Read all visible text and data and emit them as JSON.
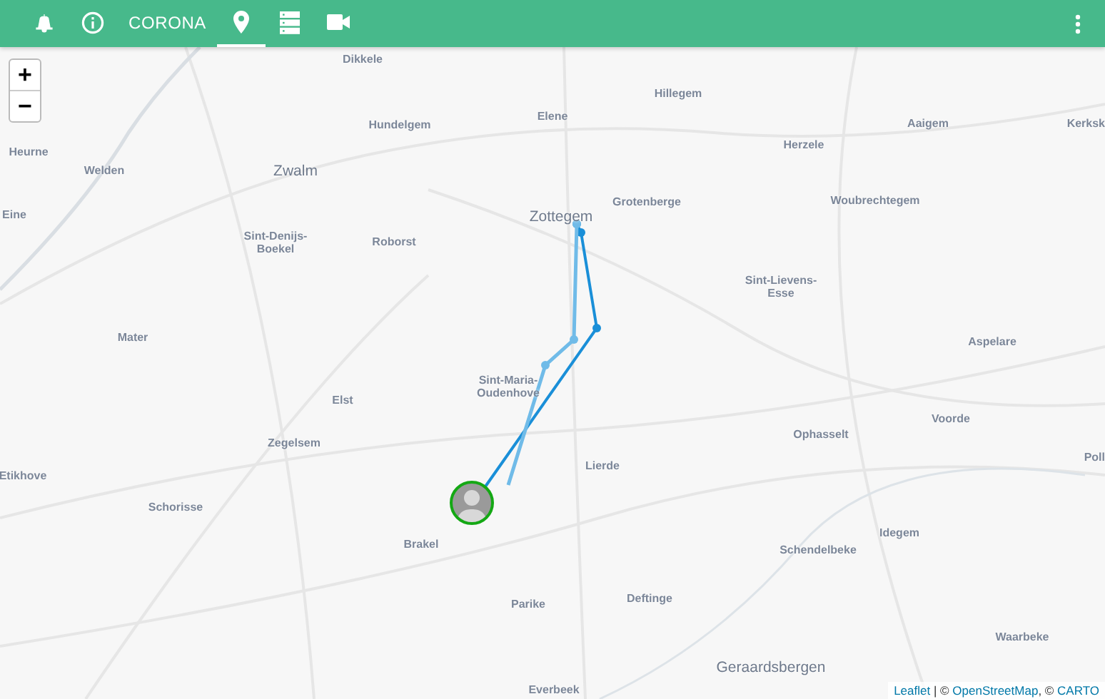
{
  "app_bar": {
    "tabs": [
      {
        "kind": "icon",
        "selected": false
      },
      {
        "kind": "icon",
        "selected": false
      },
      {
        "kind": "text",
        "label": "CORONA",
        "selected": false
      },
      {
        "kind": "icon",
        "selected": true
      },
      {
        "kind": "icon",
        "selected": false
      },
      {
        "kind": "icon",
        "selected": false
      }
    ]
  },
  "map": {
    "zoom_controls": [
      "+",
      "−"
    ],
    "place_labels": [
      {
        "text": "Dikkele",
        "kind": "village"
      },
      {
        "text": "Hundelgem",
        "kind": "village"
      },
      {
        "text": "Elene",
        "kind": "village"
      },
      {
        "text": "Hillegem",
        "kind": "village"
      },
      {
        "text": "Aaigem",
        "kind": "village"
      },
      {
        "text": "Kerksk",
        "kind": "village"
      },
      {
        "text": "Heurne",
        "kind": "village"
      },
      {
        "text": "Welden",
        "kind": "village"
      },
      {
        "text": "Zwalm",
        "kind": "town"
      },
      {
        "text": "Herzele",
        "kind": "village"
      },
      {
        "text": "Grotenberge",
        "kind": "village"
      },
      {
        "text": "Woubrechtegem",
        "kind": "village"
      },
      {
        "text": "Zottegem",
        "kind": "town"
      },
      {
        "text": "Eine",
        "kind": "village"
      },
      {
        "text": "Sint-Denijs-\nBoekel",
        "kind": "village"
      },
      {
        "text": "Roborst",
        "kind": "village"
      },
      {
        "text": "Sint-Lievens-\nEsse",
        "kind": "village"
      },
      {
        "text": "Mater",
        "kind": "village"
      },
      {
        "text": "Aspelare",
        "kind": "village"
      },
      {
        "text": "Sint-Maria-\nOudenhove",
        "kind": "village"
      },
      {
        "text": "Elst",
        "kind": "village"
      },
      {
        "text": "Voorde",
        "kind": "village"
      },
      {
        "text": "Ophasselt",
        "kind": "village"
      },
      {
        "text": "Zegelsem",
        "kind": "village"
      },
      {
        "text": "Poll",
        "kind": "village"
      },
      {
        "text": "Lierde",
        "kind": "village"
      },
      {
        "text": "Etikhove",
        "kind": "village"
      },
      {
        "text": "Schorisse",
        "kind": "village"
      },
      {
        "text": "Brakel",
        "kind": "village"
      },
      {
        "text": "Idegem",
        "kind": "village"
      },
      {
        "text": "Schendelbeke",
        "kind": "village"
      },
      {
        "text": "Parike",
        "kind": "village"
      },
      {
        "text": "Deftinge",
        "kind": "village"
      },
      {
        "text": "Waarbeke",
        "kind": "village"
      },
      {
        "text": "Geraardsbergen",
        "kind": "town"
      },
      {
        "text": "Everbeek",
        "kind": "village"
      }
    ],
    "tracks": [
      {
        "color": "#1a8fd8"
      },
      {
        "color": "#70bbe8"
      }
    ],
    "attribution": [
      {
        "kind": "link",
        "text": "Leaflet"
      },
      {
        "kind": "text",
        "text": " | © "
      },
      {
        "kind": "link",
        "text": "OpenStreetMap"
      },
      {
        "kind": "text",
        "text": ", © "
      },
      {
        "kind": "link",
        "text": "CARTO"
      }
    ]
  }
}
